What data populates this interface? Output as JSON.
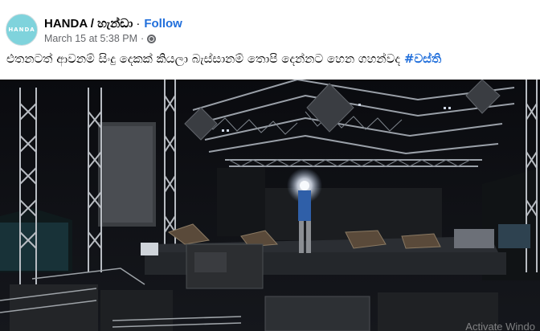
{
  "post": {
    "avatar_text": "HANDA",
    "page_name": "HANDA / හැන්ඩා",
    "separator": "·",
    "follow_label": "Follow",
    "timestamp": "March 15 at 5:38 PM",
    "meta_separator": "·",
    "privacy_icon": "globe-icon",
    "caption_text": "එතනටත් ආවනම් සිංදු දෙකක් කියලා බැස්සානම් තොපි දෙන්නට හෙන ගහන්වද ",
    "hashtag": "#වස්ති"
  },
  "media": {
    "watermark": "Activate Windo"
  },
  "colors": {
    "link": "#216fdb",
    "text": "#050505",
    "meta": "#65676b",
    "avatar_bg": "#7fd3dc"
  }
}
